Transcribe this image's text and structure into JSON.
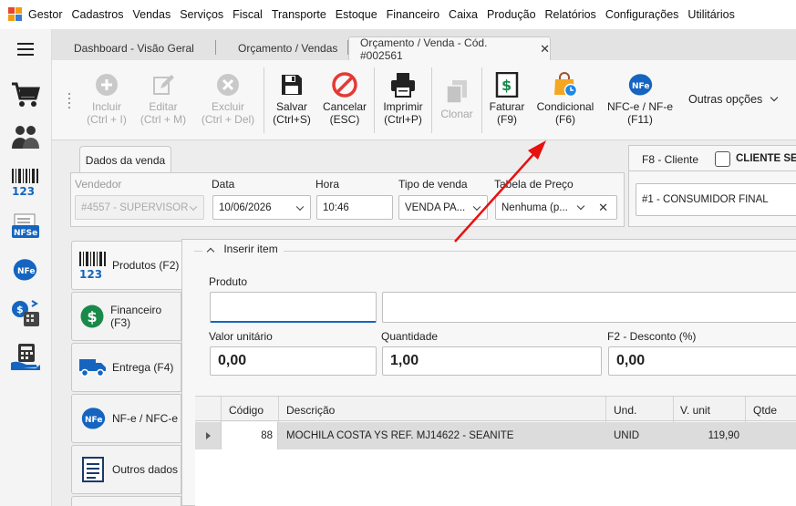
{
  "menu": {
    "app_name": "Gestor",
    "items": [
      "Cadastros",
      "Vendas",
      "Serviços",
      "Fiscal",
      "Transporte",
      "Estoque",
      "Financeiro",
      "Caixa",
      "Produção",
      "Relatórios",
      "Configurações",
      "Utilitários"
    ]
  },
  "tabs": {
    "dashboard": "Dashboard - Visão Geral",
    "orcamento": "Orçamento / Vendas",
    "active": "Orçamento / Venda - Cód. #002561",
    "close_glyph": "✕"
  },
  "toolbar": {
    "incluir": {
      "label": "Incluir",
      "shortcut": "(Ctrl + I)"
    },
    "editar": {
      "label": "Editar",
      "shortcut": "(Ctrl + M)"
    },
    "excluir": {
      "label": "Excluir",
      "shortcut": "(Ctrl + Del)"
    },
    "salvar": {
      "label": "Salvar",
      "shortcut": "(Ctrl+S)"
    },
    "cancelar": {
      "label": "Cancelar",
      "shortcut": "(ESC)"
    },
    "imprimir": {
      "label": "Imprimir",
      "shortcut": "(Ctrl+P)"
    },
    "clonar": {
      "label": "Clonar"
    },
    "faturar": {
      "label": "Faturar",
      "shortcut": "(F9)"
    },
    "condicional": {
      "label": "Condicional",
      "shortcut": "(F6)"
    },
    "nfce": {
      "label": "NFC-e / NF-e",
      "shortcut": "(F11)"
    },
    "more": "Outras opções"
  },
  "venda": {
    "section_title": "Dados da venda",
    "vendedor_label": "Vendedor",
    "vendedor_value": "#4557 - SUPERVISOR",
    "data_label": "Data",
    "data_value": "10/06/2026",
    "hora_label": "Hora",
    "hora_value": "10:46",
    "tipo_label": "Tipo de venda",
    "tipo_value": "VENDA PA...",
    "tabela_label": "Tabela de Preço",
    "tabela_value": "Nenhuma (p..."
  },
  "cliente": {
    "section_title": "F8 - Cliente",
    "checkbox_label": "CLIENTE SEM",
    "value": "#1 - CONSUMIDOR FINAL"
  },
  "side_tabs": [
    "Produtos (F2)",
    "Financeiro (F3)",
    "Entrega (F4)",
    "NF-e / NFC-e",
    "Outros dados"
  ],
  "insert": {
    "title": "Inserir item",
    "produto_label": "Produto",
    "valor_label": "Valor unitário",
    "valor_value": "0,00",
    "qtd_label": "Quantidade",
    "qtd_value": "1,00",
    "desc_label": "F2 - Desconto (%)",
    "desc_value": "0,00"
  },
  "grid": {
    "columns": [
      "Código",
      "Descrição",
      "Und.",
      "V. unit",
      "Qtde"
    ],
    "rows": [
      {
        "codigo": "88",
        "descricao": "MOCHILA COSTA YS REF. MJ14622 - SEANITE",
        "und": "UNID",
        "vunit": "119,90",
        "qtde": ""
      }
    ]
  },
  "icons": {
    "rail": [
      "menu-icon",
      "cart-icon",
      "people-icon",
      "barcode-icon",
      "nfse-icon",
      "nfe-icon",
      "money-register-icon",
      "calculator-hand-icon"
    ]
  },
  "colors": {
    "accent_red": "#e8452c",
    "arrow_red": "#e81010",
    "money_green": "#1a8a4a",
    "truck_blue": "#1565c0"
  }
}
